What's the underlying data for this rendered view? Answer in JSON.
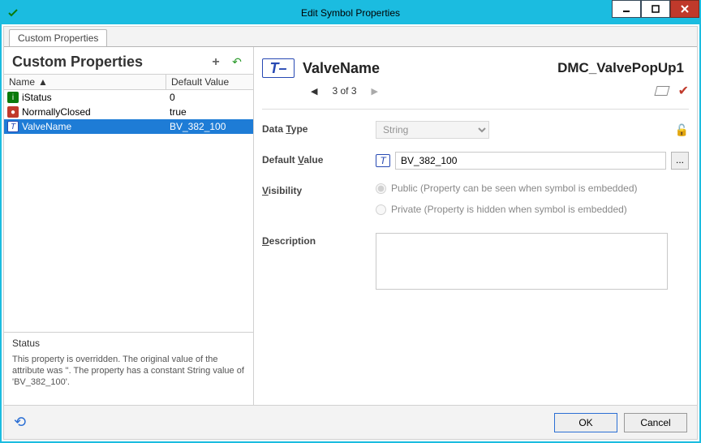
{
  "window": {
    "title": "Edit Symbol Properties"
  },
  "tabs": {
    "custom": "Custom Properties"
  },
  "left": {
    "heading": "Custom Properties",
    "cols": {
      "name": "Name",
      "default": "Default Value"
    },
    "rows": [
      {
        "icon": "status",
        "name": "iStatus",
        "value": "0"
      },
      {
        "icon": "closed",
        "name": "NormallyClosed",
        "value": "true"
      },
      {
        "icon": "t",
        "name": "ValveName",
        "value": "BV_382_100"
      }
    ],
    "status_title": "Status",
    "status_body": "This property is overridden. The original value of the attribute was ''. The property has a constant String value of 'BV_382_100'."
  },
  "right": {
    "property_name": "ValveName",
    "symbol_name": "DMC_ValvePopUp1",
    "pager_text": "3 of 3",
    "data_type_label_pre": "Data ",
    "data_type_label_ul": "T",
    "data_type_label_post": "ype",
    "data_type_value": "String",
    "default_value_label_pre": "Default ",
    "default_value_label_ul": "V",
    "default_value_label_post": "alue",
    "default_value": "BV_382_100",
    "browse_label": "...",
    "visibility_label_ul": "V",
    "visibility_label_post": "isibility",
    "vis_public": "Public (Property can be seen when symbol is embedded)",
    "vis_private": "Private (Property is hidden when symbol is embedded)",
    "description_label_ul": "D",
    "description_label_post": "escription",
    "description_value": ""
  },
  "footer": {
    "ok": "OK",
    "cancel": "Cancel"
  }
}
